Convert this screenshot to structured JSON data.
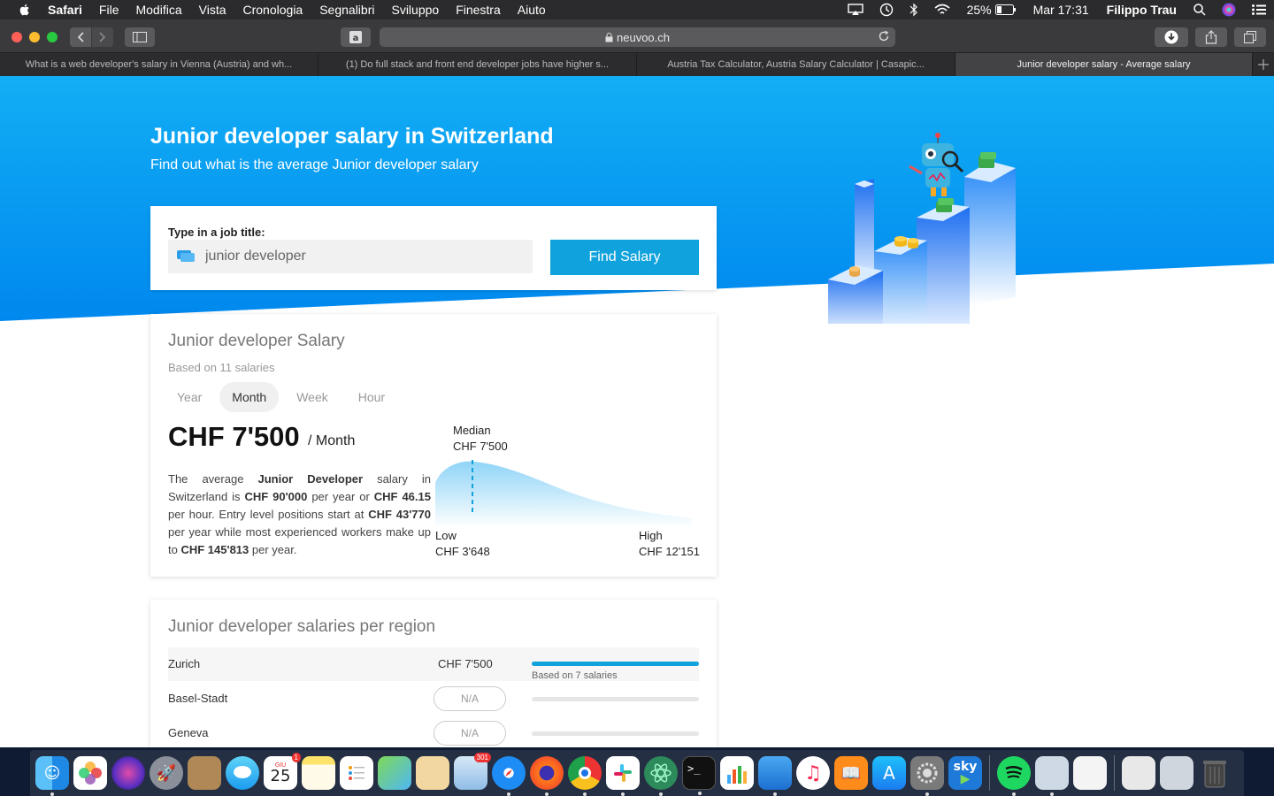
{
  "menubar": {
    "app": "Safari",
    "items": [
      "File",
      "Modifica",
      "Vista",
      "Cronologia",
      "Segnalibri",
      "Sviluppo",
      "Finestra",
      "Aiuto"
    ],
    "battery": "25%",
    "clock": "Mar 17:31",
    "user": "Filippo Trau"
  },
  "toolbar": {
    "url": "neuvoo.ch"
  },
  "tabs": [
    {
      "label": "What is a web developer's salary in Vienna (Austria) and wh..."
    },
    {
      "label": "(1) Do full stack and front end developer jobs have higher s..."
    },
    {
      "label": "Austria Tax Calculator, Austria Salary Calculator | Casapic..."
    },
    {
      "label": "Junior developer salary - Average salary"
    }
  ],
  "hero": {
    "title": "Junior developer salary in Switzerland",
    "subtitle": "Find out what is the average Junior developer salary"
  },
  "search": {
    "label": "Type in a job title:",
    "value": "junior developer",
    "button": "Find Salary"
  },
  "salary": {
    "title": "Junior developer Salary",
    "based_on": "Based on 11 salaries",
    "periods": [
      "Year",
      "Month",
      "Week",
      "Hour"
    ],
    "active_period": "Month",
    "amount": "CHF 7'500",
    "per": "/ Month",
    "desc": {
      "p1": "The average ",
      "b1": "Junior Developer",
      "p2": " salary in Switzerland is ",
      "b2": "CHF 90'000",
      "p3": " per year or ",
      "b3": "CHF 46.15",
      "p4": " per hour. Entry level positions start at ",
      "b4": "CHF 43'770",
      "p5": " per year while most experienced workers make up to ",
      "b5": "CHF 145'813",
      "p6": " per year."
    },
    "median_label": "Median",
    "median_value": "CHF 7'500",
    "low_label": "Low",
    "low_value": "CHF 3'648",
    "high_label": "High",
    "high_value": "CHF 12'151"
  },
  "regions": {
    "title": "Junior developer salaries per region",
    "rows": [
      {
        "name": "Zurich",
        "value": "CHF 7'500",
        "bar": 1.0,
        "note": "Based on 7 salaries"
      },
      {
        "name": "Basel-Stadt",
        "value": "N/A",
        "bar": 0
      },
      {
        "name": "Geneva",
        "value": "N/A",
        "bar": 0
      }
    ]
  },
  "dock": {
    "calendar_month": "GIU",
    "calendar_day": "25",
    "calendar_badge": "1",
    "mail_badge": "301",
    "sky_label": "sky"
  },
  "colors": {
    "hero_blue": "#0096f0",
    "accent": "#10a2dc"
  }
}
